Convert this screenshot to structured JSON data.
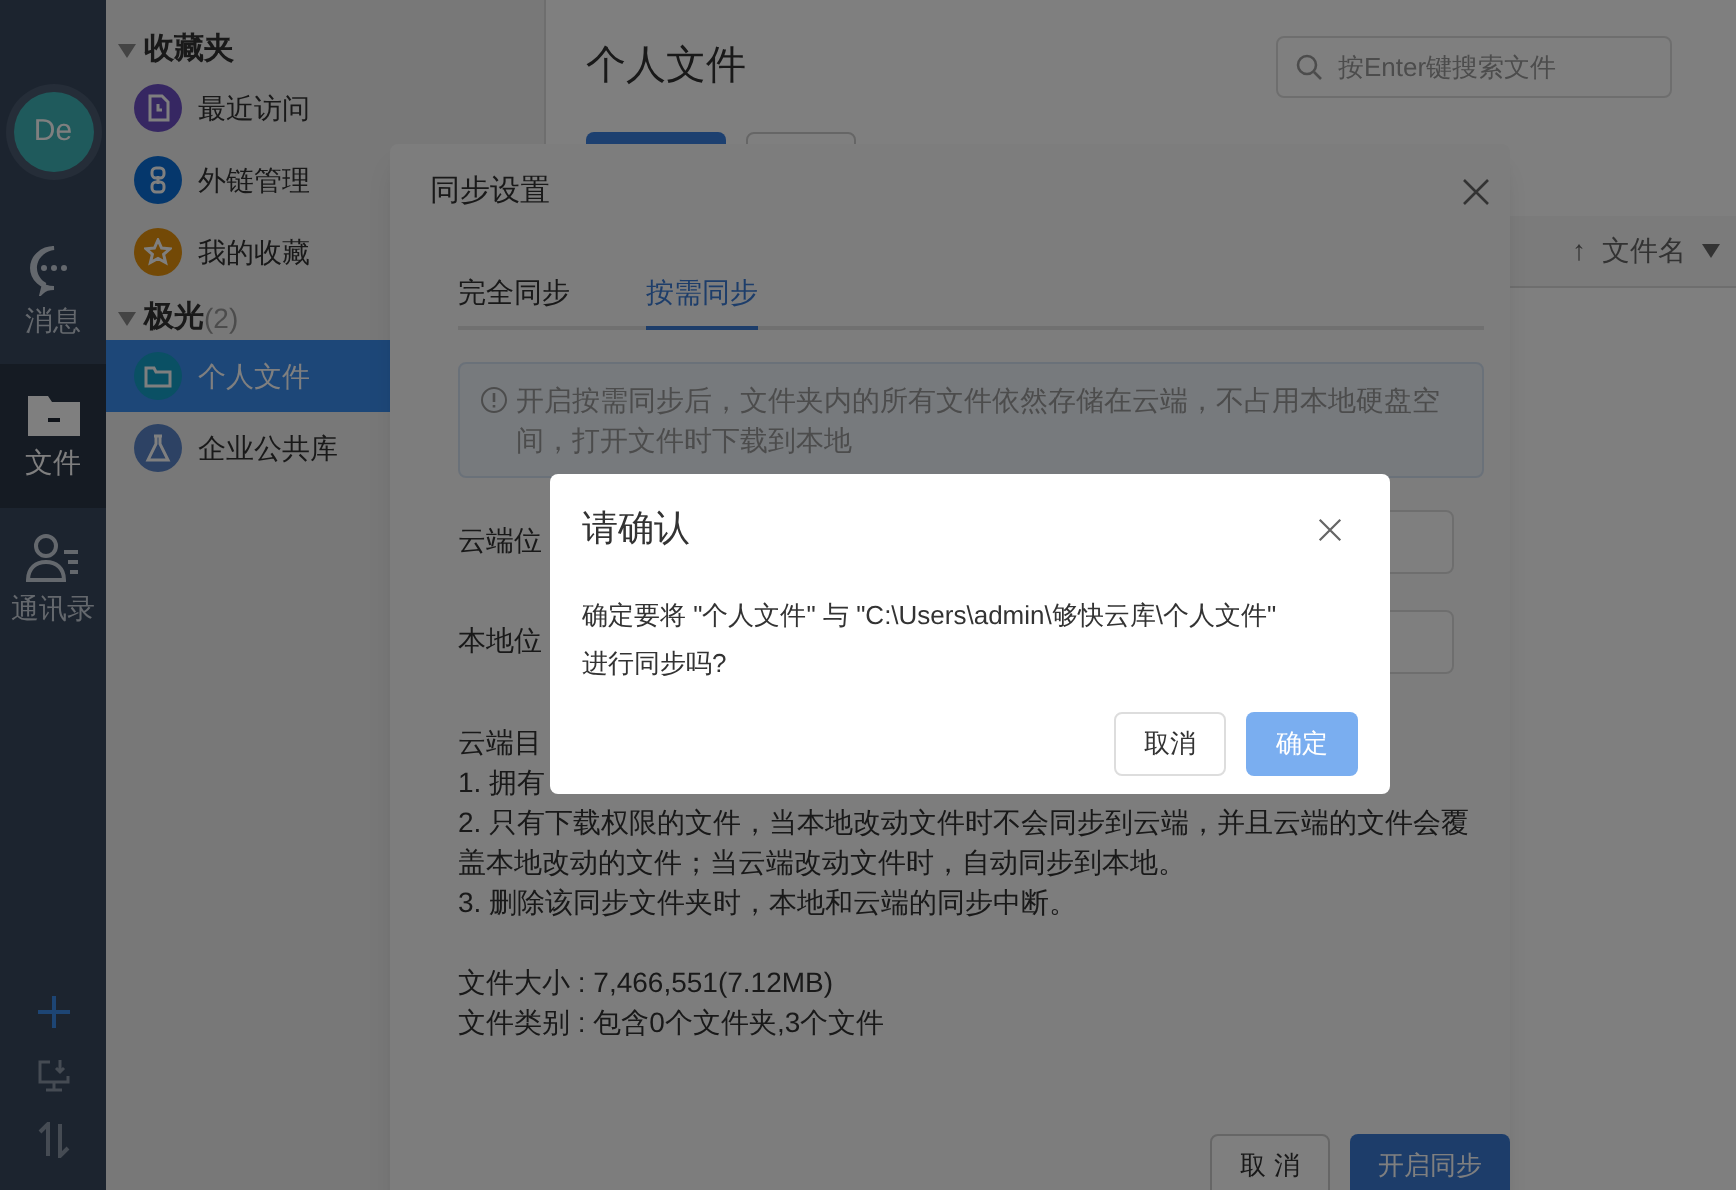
{
  "nav": {
    "avatar": "De",
    "items": [
      {
        "label": "消息",
        "selected": false
      },
      {
        "label": "文件",
        "selected": true
      },
      {
        "label": "通讯录",
        "selected": false
      }
    ]
  },
  "sidebar": {
    "groups": [
      {
        "title": "收藏夹",
        "expanded": true,
        "items": [
          {
            "label": "最近访问",
            "selected": false
          },
          {
            "label": "外链管理",
            "selected": false
          },
          {
            "label": "我的收藏",
            "selected": false
          }
        ]
      },
      {
        "title": "极光",
        "count": "(2)",
        "expanded": true,
        "items": [
          {
            "label": "个人文件",
            "selected": true
          },
          {
            "label": "企业公共库",
            "selected": false
          }
        ]
      }
    ]
  },
  "main": {
    "title": "个人文件",
    "search": {
      "placeholder": "按Enter键搜索文件"
    },
    "sort_arrow": "↑",
    "sort_column": "文件名"
  },
  "sync_dialog": {
    "title": "同步设置",
    "tabs": [
      {
        "label": "完全同步",
        "selected": false
      },
      {
        "label": "按需同步",
        "selected": true
      }
    ],
    "notice": "开启按需同步后，文件夹内的所有文件依然存储在云端，不占用本地硬盘空间，打开文件时下载到本地",
    "fields": [
      {
        "label": "云端位"
      },
      {
        "label": "本地位"
      }
    ],
    "notes": [
      "云端目",
      "1. 拥有",
      "2. 只有下载权限的文件，当本地改动文件时不会同步到云端，并且云端的文件会覆盖本地改动的文件；当云端改动文件时，自动同步到本地。",
      "3. 删除该同步文件夹时，本地和云端的同步中断。"
    ],
    "info": [
      "文件大小 : 7,466,551(7.12MB)",
      "文件类别 : 包含0个文件夹,3个文件"
    ],
    "cancel": "取 消",
    "confirm": "开启同步"
  },
  "confirm_dialog": {
    "title": "请确认",
    "message": [
      "确定要将 \"个人文件\" 与 \"C:\\Users\\admin\\够快云库\\个人文件\"",
      "进行同步吗?"
    ],
    "cancel": "取消",
    "ok": "确定"
  }
}
